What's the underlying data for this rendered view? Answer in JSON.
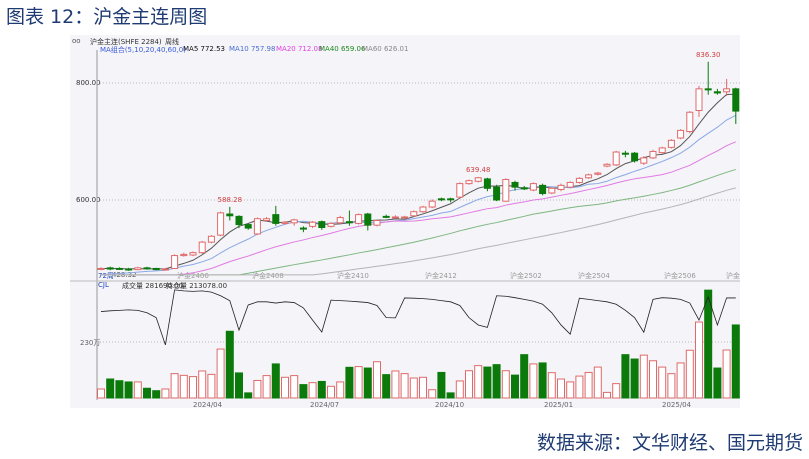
{
  "title": "图表 12：沪金主连周图",
  "source": "数据来源：文华财经、国元期货",
  "header": {
    "icons": "oo",
    "instrument": "沪金主连(SHFE 2284)",
    "period": "周线",
    "ma_group": "MA组合(5,10,20,40,60,0)",
    "ma5": "MA5 772.53",
    "ma10": "MA10 757.98",
    "ma20": "MA20 712.08",
    "ma40": "MA40 659.06",
    "ma60": "MA60 626.01"
  },
  "colors": {
    "up": "#e06a6a",
    "down": "#0b7a0b",
    "ma5": "#555555",
    "ma10": "#8aa8e6",
    "ma20": "#e27ae2",
    "ma40": "#7fb67f",
    "ma60": "#b5b5b5",
    "legend_group": "#3b5bdb",
    "ma10_text": "#4a6fd0",
    "ma20_text": "#e040e0",
    "ma40_text": "#1a8a1a",
    "ma60_text": "#888888"
  },
  "sub_header": {
    "indicator": "CJL",
    "volume": "成交量 281690.00",
    "open_interest": "持仓量 213078.00"
  },
  "left_info": {
    "weeks": "72周",
    "low": "428.32"
  },
  "chart_data": [
    {
      "type": "candlestick",
      "ylim": [
        472,
        845
      ],
      "yticks": [
        "800.00",
        "600.00"
      ],
      "ytick_values": [
        800,
        600
      ],
      "grid": "dotted-horizontal",
      "annotations": [
        {
          "text": "588.28",
          "index": 14,
          "value": 588.28
        },
        {
          "text": "639.48",
          "index": 41,
          "value": 639.48
        },
        {
          "text": "836.30",
          "index": 66,
          "value": 836.3
        }
      ],
      "contract_labels": [
        "沪金2406",
        "沪金2408",
        "沪金2410",
        "沪金2412",
        "沪金2502",
        "沪金2504",
        "沪金2506",
        "沪金"
      ],
      "ohlc": [
        [
          482,
          485,
          480,
          483
        ],
        [
          484,
          486,
          480,
          482
        ],
        [
          483,
          485,
          481,
          482
        ],
        [
          482,
          484,
          479,
          481
        ],
        [
          481,
          486,
          480,
          484
        ],
        [
          484,
          486,
          481,
          483
        ],
        [
          483,
          484,
          480,
          481
        ],
        [
          481,
          484,
          480,
          482
        ],
        [
          483,
          507,
          482,
          505
        ],
        [
          505,
          510,
          503,
          507
        ],
        [
          506,
          512,
          504,
          510
        ],
        [
          510,
          530,
          508,
          528
        ],
        [
          528,
          540,
          526,
          538
        ],
        [
          540,
          580,
          538,
          578
        ],
        [
          576,
          588.28,
          565,
          573
        ],
        [
          572,
          574,
          552,
          558
        ],
        [
          558,
          560,
          549,
          552
        ],
        [
          542,
          570,
          540,
          568
        ],
        [
          565,
          571,
          563,
          568
        ],
        [
          575,
          590,
          556,
          560
        ],
        [
          560,
          564,
          558,
          562
        ],
        [
          561,
          568,
          556,
          566
        ],
        [
          552,
          555,
          545,
          551
        ],
        [
          555,
          564,
          552,
          562
        ],
        [
          563,
          565,
          549,
          553
        ],
        [
          555,
          562,
          553,
          560
        ],
        [
          561,
          573,
          559,
          570
        ],
        [
          563,
          582,
          556,
          561
        ],
        [
          560,
          577,
          558,
          575
        ],
        [
          576,
          578,
          548,
          557
        ],
        [
          557,
          566,
          555,
          565
        ],
        [
          572,
          575,
          569,
          571
        ],
        [
          570,
          574,
          568,
          571
        ],
        [
          570,
          573,
          568,
          571
        ],
        [
          573,
          582,
          571,
          580
        ],
        [
          580,
          590,
          578,
          588
        ],
        [
          588,
          601,
          586,
          598
        ],
        [
          602,
          604,
          598,
          601
        ],
        [
          602,
          604,
          596,
          601
        ],
        [
          605,
          630,
          603,
          628
        ],
        [
          628,
          635,
          626,
          633
        ],
        [
          632,
          639.48,
          630,
          638
        ],
        [
          636,
          638,
          615,
          620
        ],
        [
          622,
          626,
          598,
          600
        ],
        [
          598,
          637,
          597,
          635
        ],
        [
          630,
          633,
          616,
          622
        ],
        [
          621,
          624,
          617,
          619
        ],
        [
          617,
          630,
          615,
          628
        ],
        [
          625,
          628,
          608,
          611
        ],
        [
          612,
          622,
          610,
          620
        ],
        [
          618,
          628,
          615,
          625
        ],
        [
          622,
          632,
          620,
          630
        ],
        [
          630,
          639,
          628,
          637
        ],
        [
          638,
          645,
          636,
          643
        ],
        [
          644,
          648,
          642,
          646
        ],
        [
          658,
          663,
          656,
          661
        ],
        [
          660,
          684,
          658,
          682
        ],
        [
          680,
          684,
          673,
          679
        ],
        [
          680,
          682,
          664,
          667
        ],
        [
          663,
          675,
          660,
          672
        ],
        [
          672,
          686,
          670,
          683
        ],
        [
          681,
          691,
          679,
          689
        ],
        [
          690,
          704,
          688,
          702
        ],
        [
          706,
          721,
          704,
          719
        ],
        [
          717,
          752,
          714,
          750
        ],
        [
          753,
          795,
          742,
          790
        ],
        [
          790,
          836.3,
          780,
          789
        ],
        [
          785,
          790,
          780,
          783
        ],
        [
          785,
          807,
          778,
          790
        ],
        [
          790,
          792,
          730,
          752
        ]
      ],
      "moving_averages": [
        5,
        10,
        20,
        40,
        60
      ]
    },
    {
      "type": "bar+line",
      "ytick": "230万",
      "ytick_value": 230,
      "unit": "万",
      "xticks": [
        "2024/04",
        "2024/07",
        "2024/10",
        "2025/01",
        "2025/04"
      ],
      "volume": [
        37,
        78,
        71,
        66,
        66,
        40,
        30,
        37,
        100,
        93,
        88,
        111,
        97,
        201,
        274,
        103,
        21,
        72,
        92,
        140,
        85,
        92,
        55,
        63,
        68,
        48,
        66,
        126,
        129,
        123,
        149,
        96,
        111,
        100,
        82,
        85,
        34,
        105,
        21,
        70,
        112,
        133,
        127,
        137,
        112,
        94,
        178,
        140,
        144,
        104,
        78,
        66,
        90,
        105,
        127,
        23,
        59,
        178,
        160,
        176,
        153,
        127,
        100,
        144,
        196,
        312,
        443,
        123,
        197,
        300
      ],
      "open_interest": [
        355,
        358,
        360,
        362,
        360,
        350,
        330,
        218,
        444,
        440,
        438,
        440,
        435,
        420,
        400,
        279,
        382,
        395,
        395,
        390,
        395,
        392,
        370,
        320,
        271,
        402,
        400,
        398,
        395,
        392,
        380,
        330,
        329,
        411,
        410,
        408,
        405,
        400,
        395,
        380,
        330,
        300,
        290,
        420,
        418,
        412,
        405,
        398,
        385,
        350,
        300,
        262,
        410,
        405,
        400,
        395,
        385,
        360,
        330,
        270,
        405,
        412,
        410,
        405,
        390,
        320,
        415,
        300,
        411,
        411
      ]
    }
  ]
}
